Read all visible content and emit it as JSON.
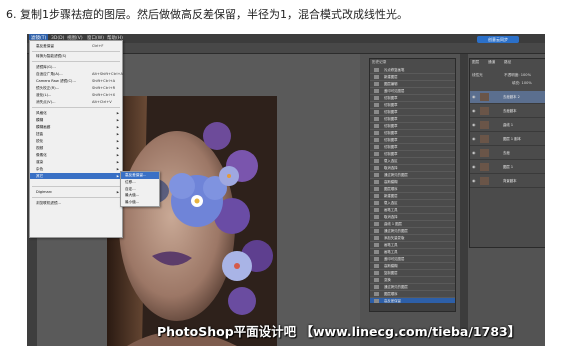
{
  "caption": "6. 复制1步骤祛痘的图层。然后做做高反差保留，半径为1，混合模式改成线性光。",
  "menubar": {
    "items": [
      "滤镜(T)",
      "3D(D)",
      "视图(V)",
      "窗口(W)",
      "帮助(H)"
    ],
    "cloud_button": "创意云同步"
  },
  "filter_menu": {
    "items": [
      {
        "label": "高反差保留",
        "shortcut": "Ctrl+F"
      },
      {
        "label": "转换为智能滤镜(S)",
        "shortcut": ""
      },
      {
        "label": "滤镜库(G)...",
        "shortcut": ""
      },
      {
        "label": "自适应广角(A)...",
        "shortcut": "Alt+Shift+Ctrl+A"
      },
      {
        "label": "Camera Raw 滤镜(C)...",
        "shortcut": "Shift+Ctrl+A"
      },
      {
        "label": "镜头校正(R)...",
        "shortcut": "Shift+Ctrl+R"
      },
      {
        "label": "液化(L)...",
        "shortcut": "Shift+Ctrl+X"
      },
      {
        "label": "消失点(V)...",
        "shortcut": "Alt+Ctrl+V"
      },
      {
        "label": "风格化",
        "shortcut": ""
      },
      {
        "label": "模糊",
        "shortcut": ""
      },
      {
        "label": "模糊画廊",
        "shortcut": ""
      },
      {
        "label": "扭曲",
        "shortcut": ""
      },
      {
        "label": "锐化",
        "shortcut": ""
      },
      {
        "label": "视频",
        "shortcut": ""
      },
      {
        "label": "像素化",
        "shortcut": ""
      },
      {
        "label": "渲染",
        "shortcut": ""
      },
      {
        "label": "杂色",
        "shortcut": ""
      },
      {
        "label": "其它",
        "shortcut": ""
      },
      {
        "label": "Digimarc",
        "shortcut": ""
      },
      {
        "label": "浏览联机滤镜...",
        "shortcut": ""
      }
    ]
  },
  "submenu": {
    "items": [
      "高反差保留...",
      "位移...",
      "自定...",
      "最大值...",
      "最小值..."
    ]
  },
  "history": {
    "tab": "历史记录",
    "items": [
      "污点修复画笔",
      "新建图层",
      "图层编辑",
      "盖印可见图层",
      "仿制图章",
      "仿制图章",
      "仿制图章",
      "仿制图章",
      "仿制图章",
      "仿制图章",
      "仿制图章",
      "仿制图章",
      "仿制图章",
      "载入选区",
      "取消选择",
      "通过拷贝的图层",
      "高斯模糊",
      "图层顺序",
      "新建图层",
      "载入选区",
      "画笔工具",
      "取消选择",
      "曲线 1 图层",
      "通过拷贝的图层",
      "添加矢量蒙版",
      "画笔工具",
      "画笔工具",
      "盖印可见图层",
      "高斯模糊",
      "复制图层",
      "变换",
      "通过拷贝的图层",
      "图层顺序",
      "高反差保留"
    ]
  },
  "layers": {
    "tabs": [
      "图层",
      "通道",
      "路径"
    ],
    "blend_mode": "线性光",
    "opacity_label": "不透明度: 100%",
    "fill_label": "填充: 100%",
    "rows": [
      {
        "name": "去痘副本 2",
        "selected": true
      },
      {
        "name": "去痘副本",
        "selected": false
      },
      {
        "name": "曲线 1",
        "selected": false
      },
      {
        "name": "图层 1 副本",
        "selected": false
      },
      {
        "name": "去痘",
        "selected": false
      },
      {
        "name": "图层 1",
        "selected": false
      },
      {
        "name": "背景副本",
        "selected": false
      }
    ]
  },
  "watermark": "PhotoShop平面设计吧 【www.linecg.com/tieba/1783】",
  "colors": {
    "accent": "#2d5fa8",
    "ui_dark": "#3c3c3c",
    "panel": "#4b4b4b"
  }
}
